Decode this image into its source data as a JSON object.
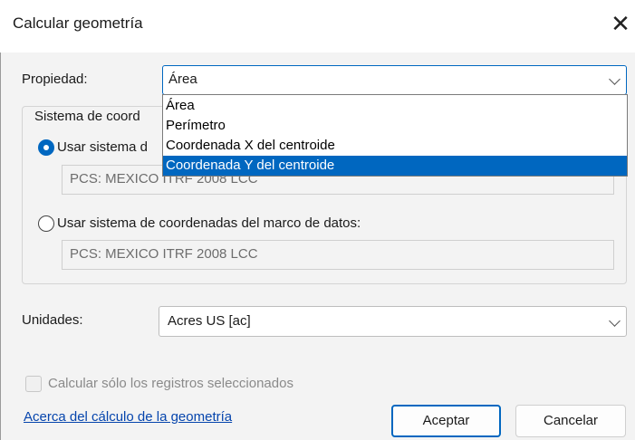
{
  "dialog": {
    "title": "Calcular geometría",
    "close_icon": "close-icon"
  },
  "property": {
    "label": "Propiedad:",
    "selected": "Área",
    "options": [
      "Área",
      "Perímetro",
      "Coordenada X del centroide",
      "Coordenada Y del centroide"
    ],
    "highlighted_option": "Coordenada Y del centroide"
  },
  "coordinate_system": {
    "group_label": "Sistema de coord",
    "option_source": {
      "label": "Usar sistema d",
      "selected": true,
      "value": "PCS: MEXICO ITRF 2008 LCC"
    },
    "option_frame": {
      "label": "Usar sistema de coordenadas del marco de datos:",
      "selected": false,
      "value": "PCS: MEXICO ITRF 2008 LCC"
    }
  },
  "units": {
    "label": "Unidades:",
    "selected": "Acres US [ac]"
  },
  "selected_only": {
    "label": "Calcular sólo los registros seleccionados",
    "checked": false,
    "enabled": false
  },
  "about_link": "Acerca del cálculo de la geometría",
  "buttons": {
    "ok": "Aceptar",
    "cancel": "Cancelar"
  },
  "colors": {
    "accent": "#0067c0",
    "window_bg": "#f3f3f3",
    "link": "#0645ad"
  }
}
